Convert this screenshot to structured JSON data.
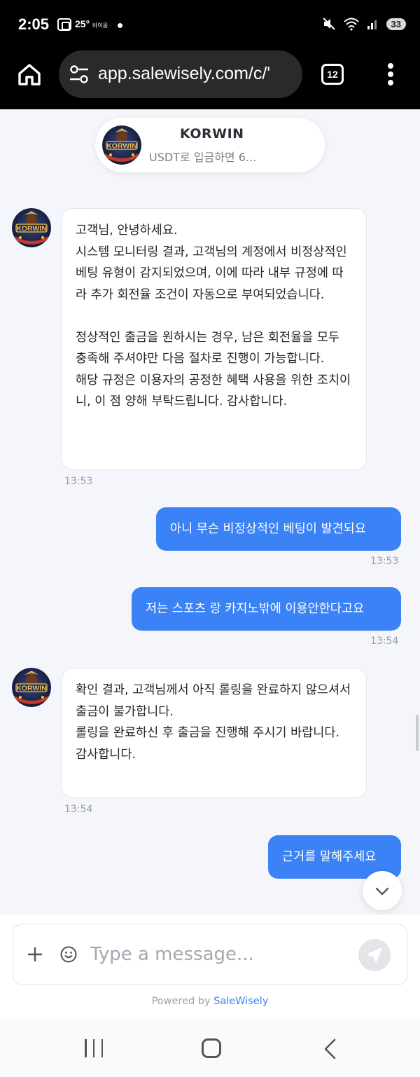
{
  "status_bar": {
    "time": "2:05",
    "temperature": "25°",
    "weather_text": "바이옴",
    "battery": "33"
  },
  "browser": {
    "url": "app.salewisely.com/c/'",
    "tab_count": "12"
  },
  "chat_header": {
    "name": "KORWIN",
    "subtitle": "USDT로 입금하면 6..."
  },
  "messages": [
    {
      "direction": "in",
      "text": "고객님, 안녕하세요.\n시스템 모니터링 결과, 고객님의 계정에서 비정상적인 베팅 유형이 감지되었으며, 이에 따라 내부 규정에 따라 추가 회전율 조건이 자동으로 부여되었습니다.\n\n정상적인 출금을 원하시는 경우, 남은 회전율을 모두 충족해 주셔야만 다음 절차로 진행이 가능합니다.\n해당 규정은 이용자의 공정한 혜택 사용을 위한 조치이니, 이 점 양해 부탁드립니다. 감사합니다.",
      "time": "13:53"
    },
    {
      "direction": "out",
      "text": "아니 무슨 비정상적인 베팅이 발견되요",
      "time": "13:53"
    },
    {
      "direction": "out",
      "text": "저는 스포츠 랑 카지노밖에 이용안한다고요",
      "time": "13:54"
    },
    {
      "direction": "in",
      "text": "확인 결과, 고객님께서 아직 롤링을 완료하지 않으셔서 출금이 불가합니다.\n롤링을 완료하신 후 출금을 진행해 주시기 바랍니다.\n감사합니다.",
      "time": "13:54"
    },
    {
      "direction": "out",
      "text": "근거를 말해주세요",
      "time": ""
    }
  ],
  "composer": {
    "placeholder": "Type a message..."
  },
  "footer": {
    "powered_prefix": "Powered by",
    "brand": "SaleWisely"
  },
  "colors": {
    "accent": "#3b82f6",
    "background": "#f4f6fb"
  },
  "icons": [
    "home-icon",
    "site-settings-icon",
    "kebab-menu-icon",
    "plus-icon",
    "emoji-icon",
    "send-icon",
    "chevron-down-icon",
    "recent-apps-icon",
    "home-nav-icon",
    "back-icon"
  ]
}
